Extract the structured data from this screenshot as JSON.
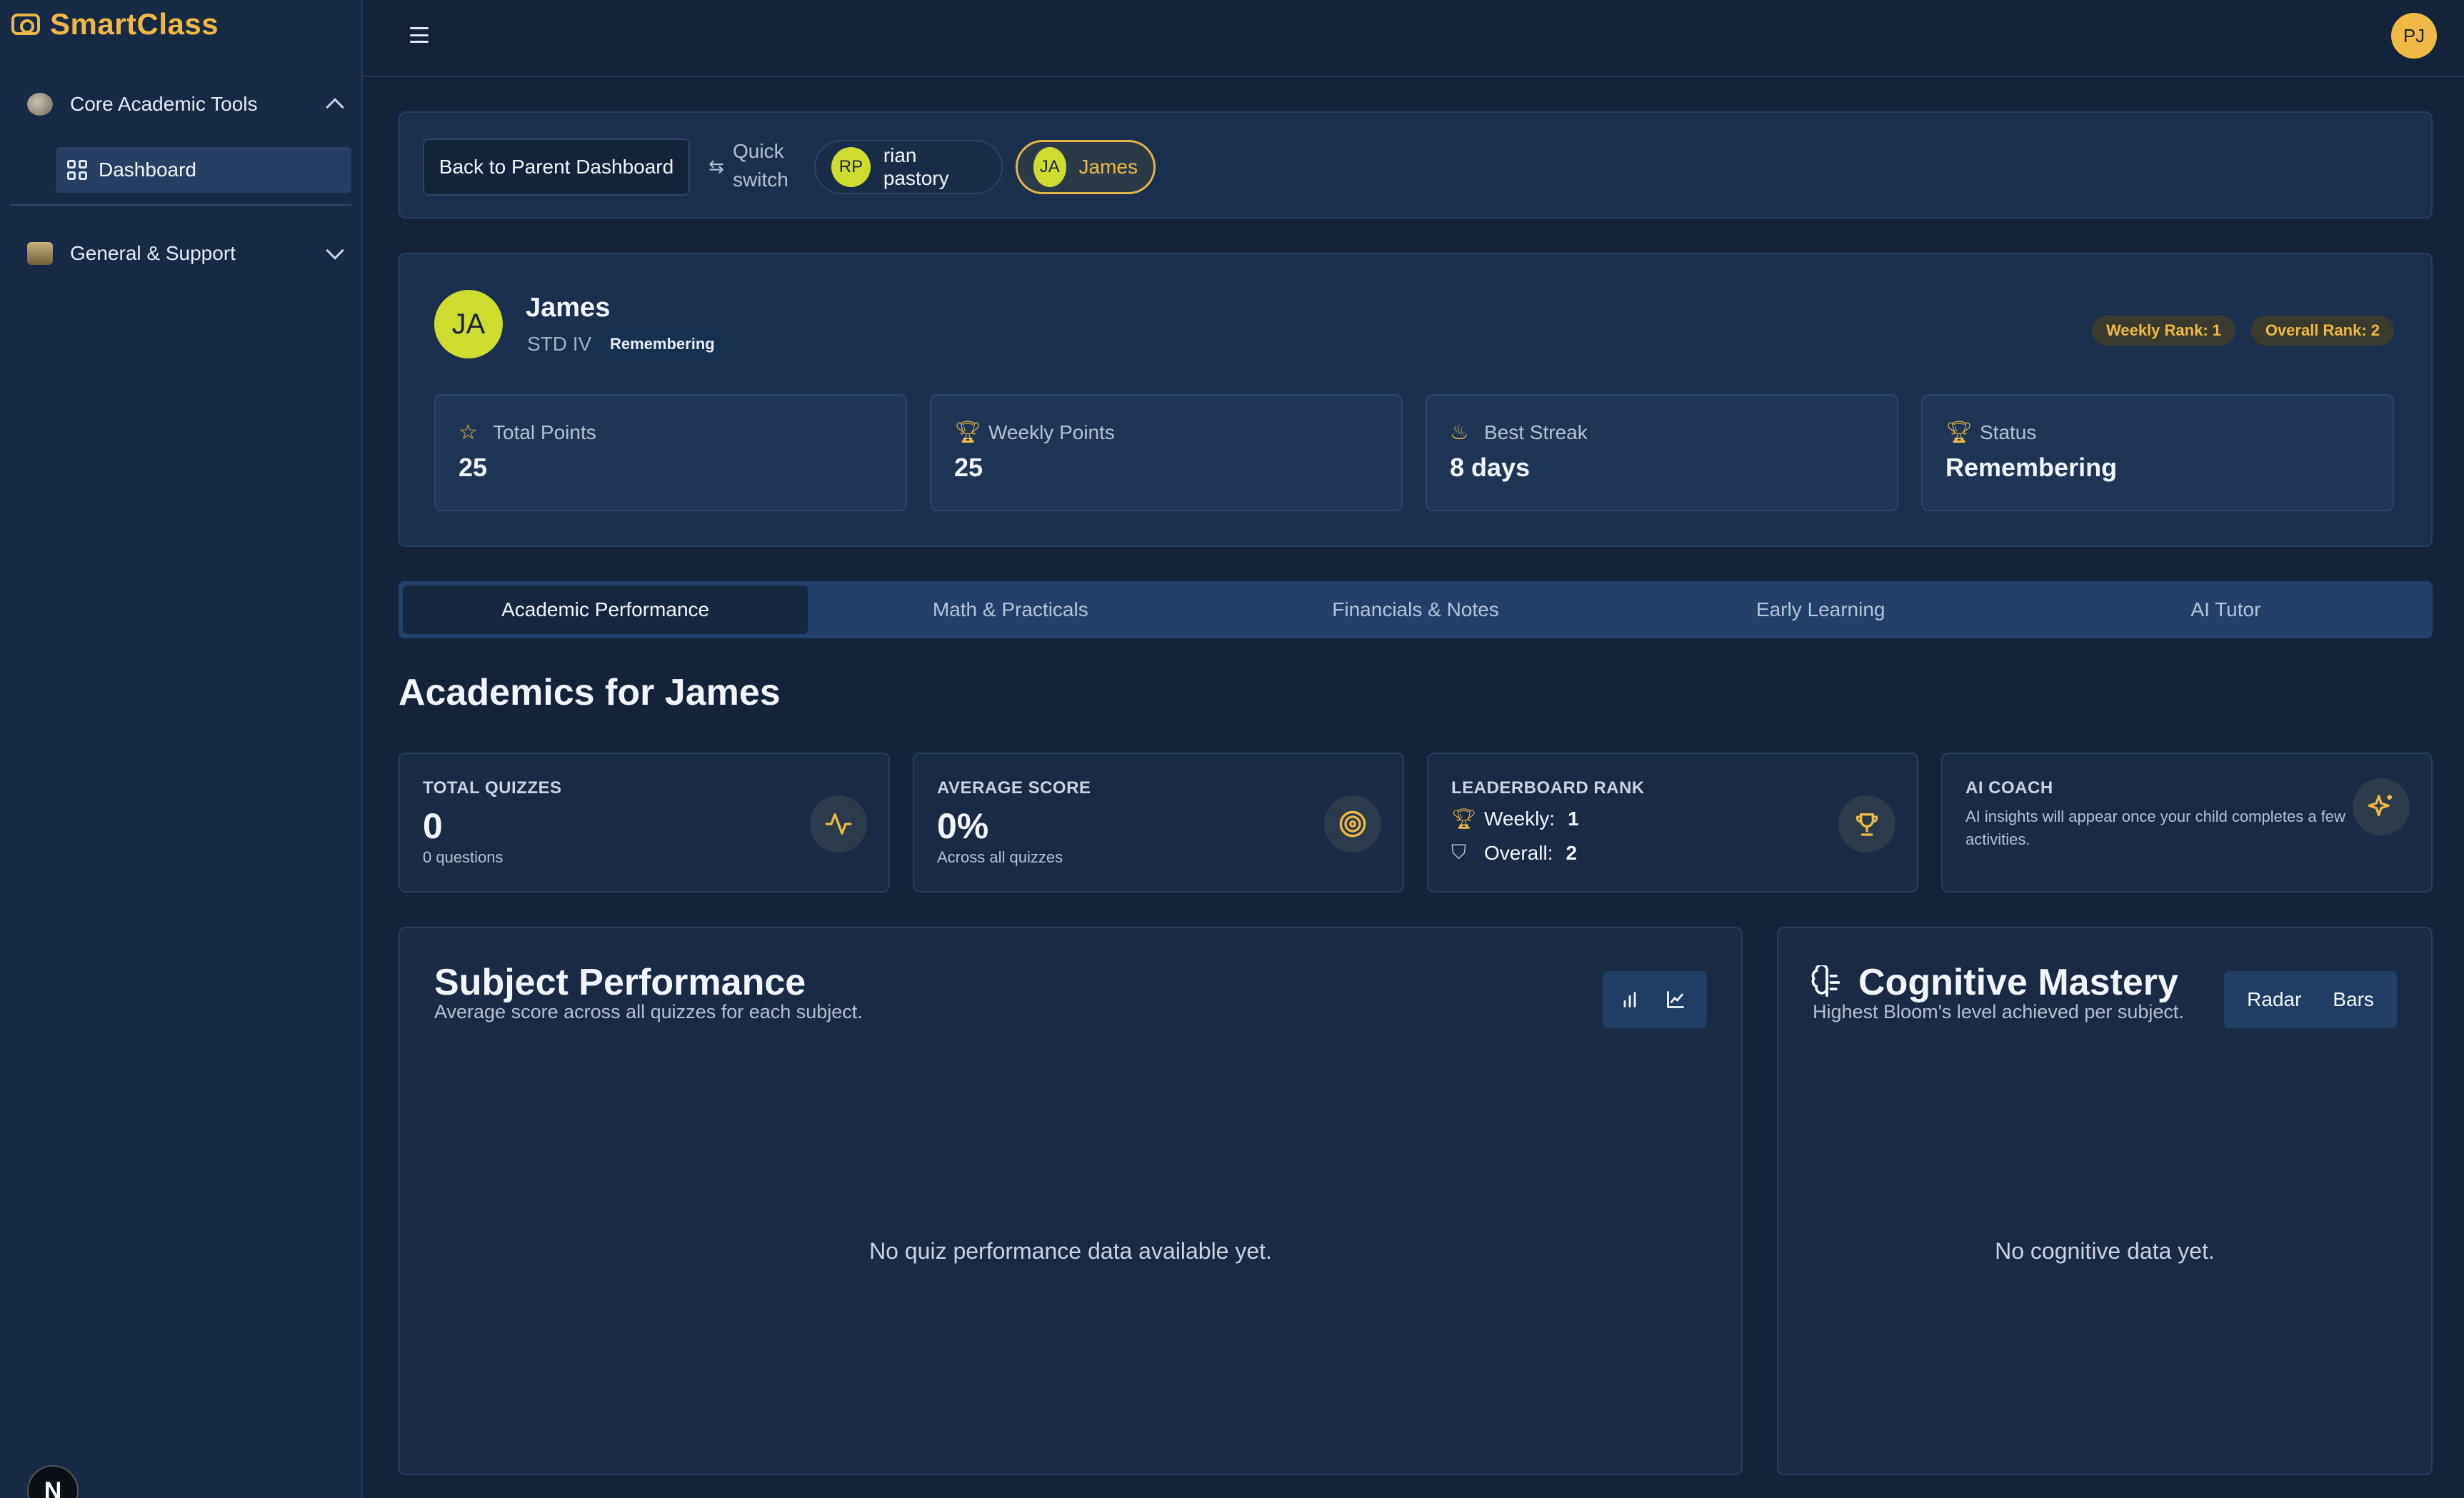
{
  "brand": {
    "name": "SmartClass"
  },
  "sidebar": {
    "groups": [
      {
        "label": "Core Academic Tools"
      },
      {
        "label": "General & Support"
      }
    ],
    "active_item": {
      "label": "Dashboard"
    }
  },
  "topbar": {
    "avatar_initials": "PJ"
  },
  "switcher": {
    "back_label": "Back to Parent Dashboard",
    "quick_label": "Quick switch",
    "children": [
      {
        "initials": "RP",
        "name": "rian pastory"
      },
      {
        "initials": "JA",
        "name": "James"
      }
    ]
  },
  "profile": {
    "initials": "JA",
    "name": "James",
    "grade": "STD IV",
    "level_badge": "Remembering",
    "weekly_rank": "Weekly Rank: 1",
    "overall_rank": "Overall Rank: 2",
    "stats": [
      {
        "icon": "star-icon",
        "label": "Total Points",
        "value": "25"
      },
      {
        "icon": "trophy-icon",
        "label": "Weekly Points",
        "value": "25"
      },
      {
        "icon": "flame-icon",
        "label": "Best Streak",
        "value": "8 days"
      },
      {
        "icon": "trophy-icon",
        "label": "Status",
        "value": "Remembering"
      }
    ]
  },
  "tabs": [
    "Academic Performance",
    "Math & Practicals",
    "Financials & Notes",
    "Early Learning",
    "AI Tutor"
  ],
  "active_tab": "Academic Performance",
  "academics": {
    "title": "Academics for James",
    "metrics": {
      "quizzes": {
        "label": "TOTAL QUIZZES",
        "value": "0",
        "sub": "0 questions"
      },
      "average": {
        "label": "AVERAGE SCORE",
        "value": "0%",
        "sub": "Across all quizzes"
      },
      "rank": {
        "label": "LEADERBOARD RANK",
        "weekly_label": "Weekly:",
        "weekly_value": "1",
        "overall_label": "Overall:",
        "overall_value": "2"
      },
      "coach": {
        "label": "AI COACH",
        "text": "AI insights will appear once your child completes a few activities."
      }
    }
  },
  "subject_performance": {
    "title": "Subject Performance",
    "subtitle": "Average score across all quizzes for each subject.",
    "empty": "No quiz performance data available yet."
  },
  "cognitive_mastery": {
    "title": "Cognitive Mastery",
    "subtitle": "Highest Bloom's level achieved per subject.",
    "toggle": [
      "Radar",
      "Bars"
    ],
    "empty": "No cognitive data yet."
  },
  "colors": {
    "accent": "#f0b944",
    "background": "#13233a",
    "card": "#1a2f4d"
  }
}
